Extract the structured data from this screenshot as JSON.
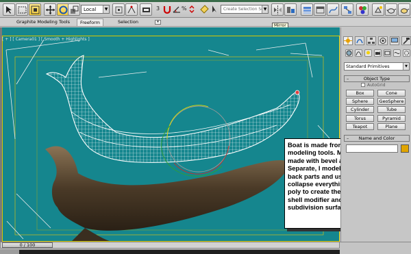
{
  "toolbar": {
    "reference_coord": "Local",
    "selection_set_placeholder": "Create Selection Se",
    "snap_label": "3",
    "percent_snap_label": "%"
  },
  "ribbon": {
    "tabs": [
      "Graphite Modeling Tools",
      "Freeform",
      "Selection"
    ],
    "active_tab": "Freeform",
    "tooltip": "Mirror"
  },
  "viewport": {
    "label": "[ + ] [ Camera01 ] [ Smooth + Highlights ]",
    "background": "#15868e"
  },
  "annotation": {
    "text": "Boat is made from a box using modeling tools. Middle part is made with bevel and extrude. Separate, I modeled front and the back parts and use bridge to collapse everything. Delete few poly to create the hole, than apply shell modifier and Nurms subdivision surface"
  },
  "command_panel": {
    "category": "Standard Primitives",
    "object_type_title": "Object Type",
    "autogrid_label": "AutoGrid",
    "buttons": [
      "Box",
      "Cone",
      "Sphere",
      "GeoSphere",
      "Cylinder",
      "Tube",
      "Torus",
      "Pyramid",
      "Teapot",
      "Plane"
    ],
    "name_color_title": "Name and Color",
    "object_color": "#e0a400"
  },
  "timeline": {
    "frame_readout": "0 / 100"
  }
}
